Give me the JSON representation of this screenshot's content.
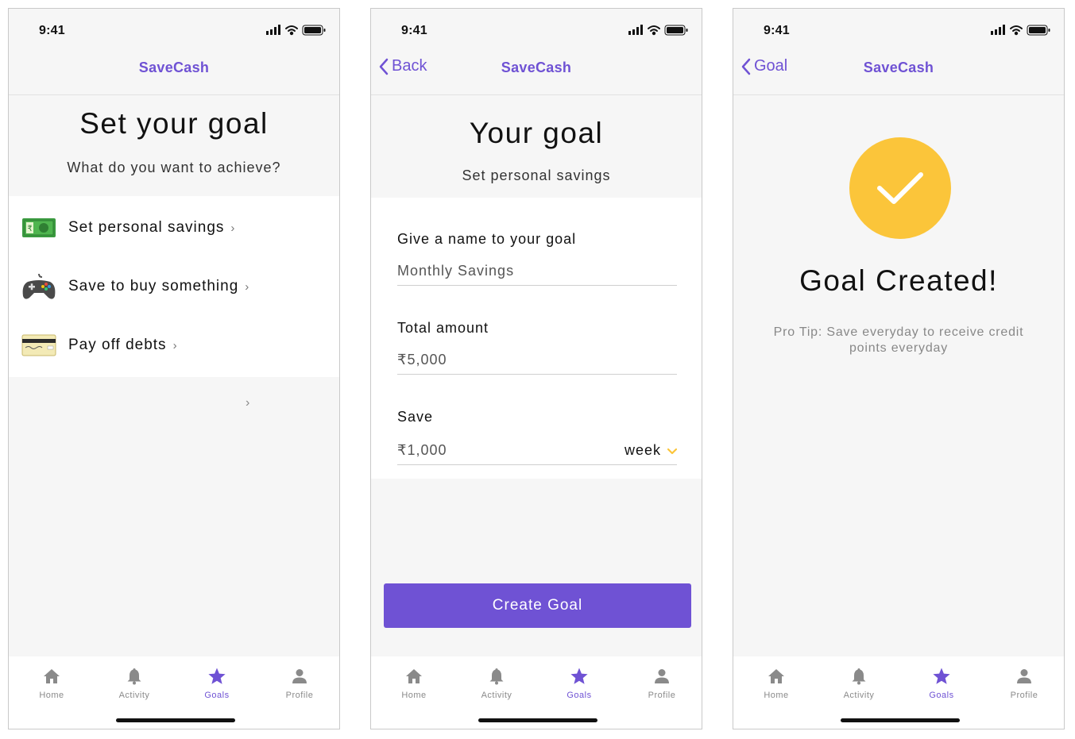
{
  "status_time": "9:41",
  "brand": "SaveCash",
  "colors": {
    "accent": "#6f52d4",
    "success": "#fbc53a",
    "background": "#f6f6f6"
  },
  "tabs": [
    {
      "label": "Home",
      "icon": "home-icon"
    },
    {
      "label": "Activity",
      "icon": "bell-icon"
    },
    {
      "label": "Goals",
      "icon": "star-icon",
      "active": true
    },
    {
      "label": "Profile",
      "icon": "person-icon"
    }
  ],
  "screen1": {
    "title": "Set your goal",
    "subtitle": "What do you want to achieve?",
    "options": [
      {
        "label": "Set personal savings",
        "icon": "money-emoji-icon"
      },
      {
        "label": "Save to buy something",
        "icon": "game-controller-icon"
      },
      {
        "label": "Pay off debts",
        "icon": "credit-card-icon"
      }
    ]
  },
  "screen2": {
    "back_label": "Back",
    "title": "Your goal",
    "subtitle": "Set personal savings",
    "name_label": "Give a name to your goal",
    "name_value": "Monthly Savings",
    "amount_label": "Total amount",
    "amount_value": "₹5,000",
    "save_label": "Save",
    "save_value": "₹1,000",
    "frequency": "week",
    "cta": "Create Goal"
  },
  "screen3": {
    "back_label": "Goal",
    "title": "Goal Created!",
    "tip": "Pro Tip: Save everyday to receive credit points everyday"
  }
}
